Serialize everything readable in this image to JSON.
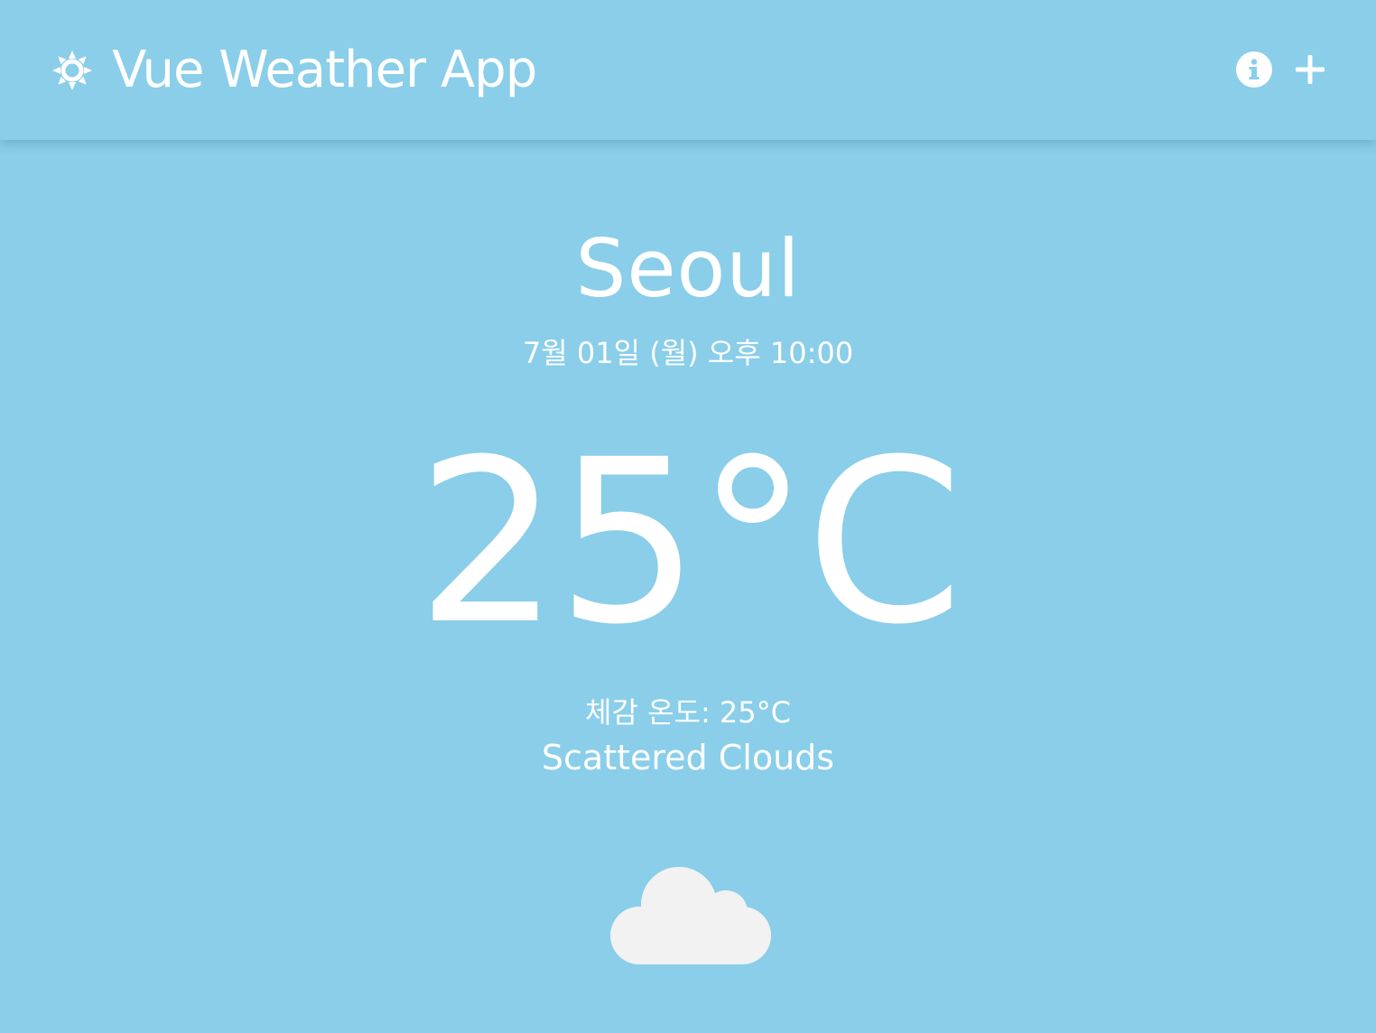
{
  "header": {
    "title": "Vue Weather App",
    "logo_icon": "sun-icon",
    "info_icon": "info-circle-icon",
    "add_icon": "plus-icon"
  },
  "weather": {
    "city": "Seoul",
    "datetime": "7월 01일 (월) 오후 10:00",
    "temperature": "25°C",
    "feels_like": "체감 온도: 25°C",
    "description": "Scattered Clouds",
    "icon": "cloud-icon"
  },
  "colors": {
    "background": "#8ACEE9",
    "text": "#FFFFFF",
    "cloud": "#F2F2F2"
  }
}
